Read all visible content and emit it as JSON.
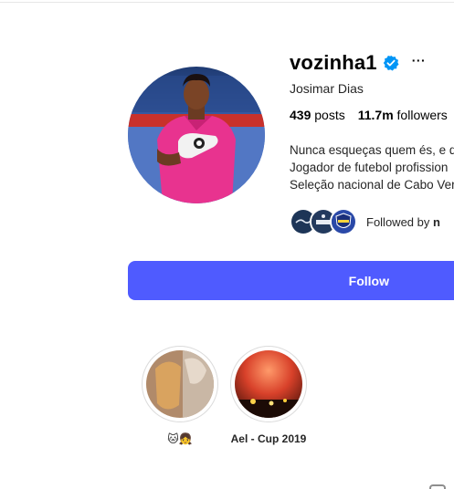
{
  "profile": {
    "username": "vozinha1",
    "more_label": "···",
    "full_name": "Josimar Dias",
    "stats": {
      "posts_count": "439",
      "posts_label": "posts",
      "followers_count": "11.7m",
      "followers_label": "followers"
    },
    "bio": [
      "Nunca esqueças quem és, e d",
      "Jogador de futebol profission",
      "Seleção nacional de Cabo Ver"
    ],
    "followed_by_label": "Followed by",
    "followed_by_names": "n",
    "follow_label": "Follow"
  },
  "highlights": [
    {
      "label": "🐱👧"
    },
    {
      "label": "Ael - Cup 2019"
    }
  ],
  "colors": {
    "follow_button": "#4f5bff",
    "verified_badge": "#0095f6",
    "jersey_pink": "#e8338f"
  },
  "icons": [
    "verified-badge-icon",
    "more-options-icon",
    "grid-icon",
    "tagged-icon"
  ]
}
